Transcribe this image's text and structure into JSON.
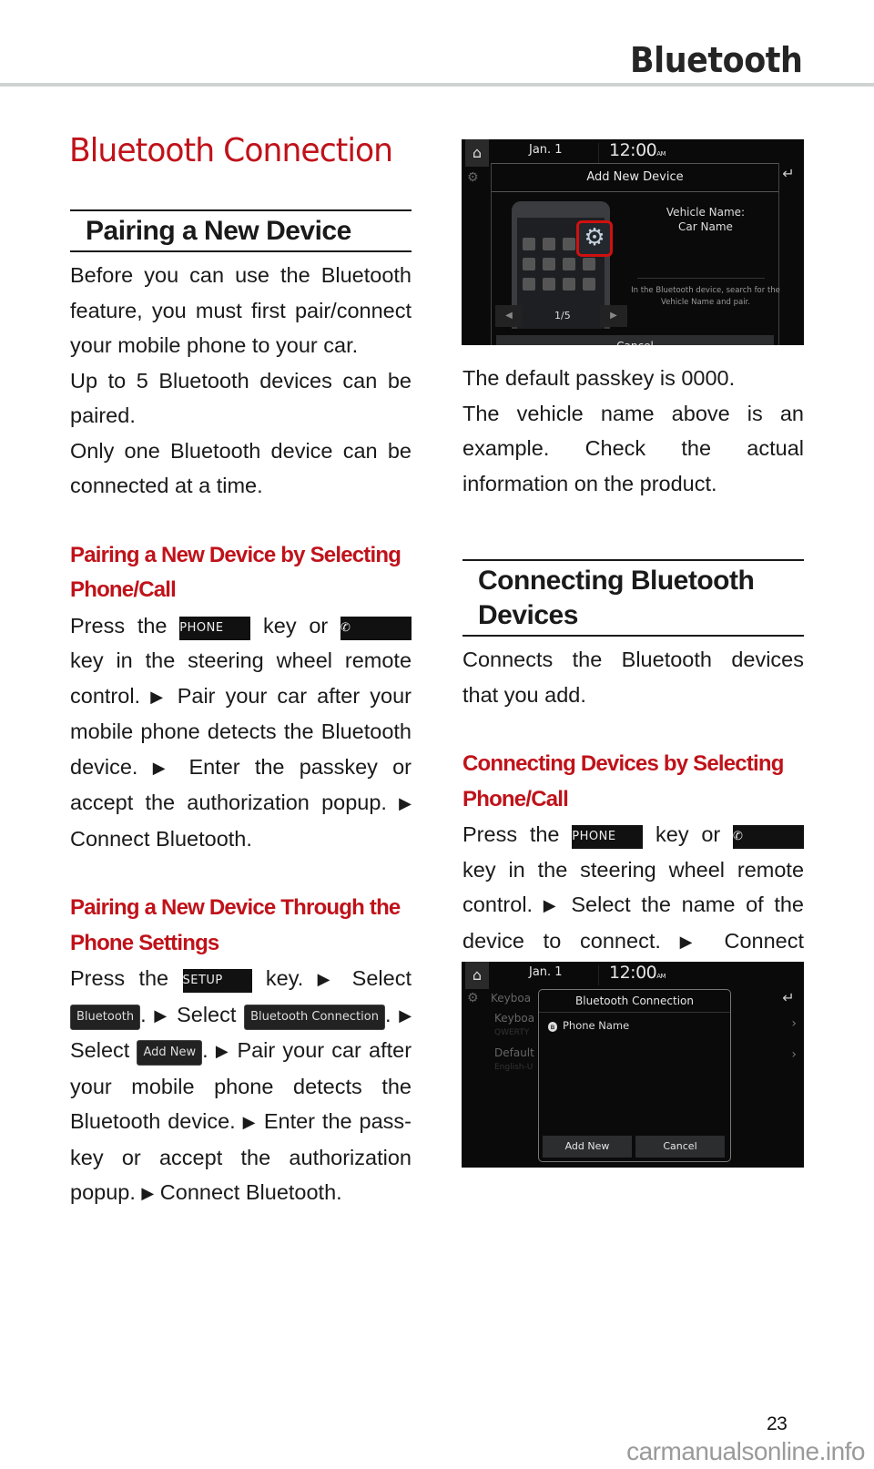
{
  "header": {
    "section_title": "Bluetooth"
  },
  "page_title": "Bluetooth Connection",
  "left": {
    "pairing": {
      "heading": "Pairing a New Device",
      "paragraphs": [
        "Before you can use the Bluetooth feature, you must first pair/connect your mobile phone to your car.",
        "Up to 5 Bluetooth devices can be paired.",
        "Only one Bluetooth device can be connected at a time."
      ]
    },
    "by_phone": {
      "heading": "Pairing a New Device by Selecting Phone/Call",
      "press_the": "Press the",
      "key_or": "key or",
      "key": "key",
      "line_rest": "in the steering wheel remote control.",
      "step1": "Pair your car after your mobile phone detects the Bluetooth device.",
      "step2": "Enter the passkey or accept the authorization popup.",
      "step3": "Connect Bluetooth."
    },
    "by_settings": {
      "heading": "Pairing a New Device Through the Phone Settings",
      "press_the": "Press the",
      "key_dot": "key.",
      "select": "Select",
      "step_pair": "Pair your car after your mobile phone detects the Bluetooth device.",
      "step_enter": "Enter the pass-key or accept the authorization popup.",
      "step_connect": "Connect Bluetooth."
    }
  },
  "keys": {
    "phone": "PHONE",
    "setup": "SETUP",
    "bluetooth_btn": "Bluetooth",
    "bt_connection_btn": "Bluetooth Connection",
    "add_new_btn": "Add New"
  },
  "screen1": {
    "date": "Jan.  1",
    "time": "12:00",
    "ampm": "AM",
    "dialog_title": "Add New Device",
    "vehicle_name_label": "Vehicle Name:",
    "vehicle_name": "Car Name",
    "note": "In the Bluetooth device, search for the Vehicle Name and pair.",
    "pager": "1/5",
    "cancel": "Cancel"
  },
  "right": {
    "passkey_note": "The default passkey is 0000.",
    "example_note": "The vehicle name above is an example. Check the actual information on the product.",
    "connecting": {
      "heading": "Connecting Bluetooth Devices",
      "intro": "Connects the Bluetooth devices that you add.",
      "sub_heading": "Connecting Devices by Selecting Phone/Call",
      "press_the": "Press the",
      "key_or": "key or",
      "key": "key",
      "line_rest": "in the steering wheel remote control.",
      "step1": "Select the name of the device to connect.",
      "step2": "Connect Bluetooth."
    }
  },
  "screen2": {
    "date": "Jan.  1",
    "time": "12:00",
    "ampm": "AM",
    "bg_item1": "Keyboa",
    "bg_item2": "Keyboa",
    "bg_item2_sub": "QWERTY",
    "bg_item3": "Default",
    "bg_item3_sub": "English-U",
    "dialog_title": "Bluetooth Connection",
    "device": "Phone Name",
    "add_new": "Add New",
    "cancel": "Cancel"
  },
  "footer": {
    "page_number": "23",
    "watermark": "carmanualsonline.info"
  },
  "colors": {
    "accent_red": "#c0121a",
    "rule_gray": "#cfd4d3"
  }
}
